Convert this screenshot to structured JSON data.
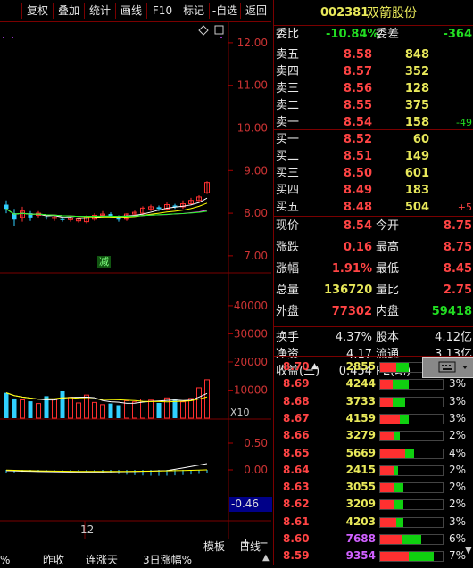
{
  "toolbar": {
    "items": [
      "复权",
      "叠加",
      "统计",
      "画线",
      "F10",
      "标记",
      "-自选",
      "返回"
    ]
  },
  "stock": {
    "code": "002381",
    "name": "双箭股份"
  },
  "order_stats": {
    "wb_label": "委比",
    "wb_value": "-10.84%",
    "wc_label": "委差",
    "wc_value": "-364"
  },
  "asks": [
    {
      "label": "卖五",
      "price": "8.58",
      "vol": "848",
      "chg": ""
    },
    {
      "label": "卖四",
      "price": "8.57",
      "vol": "352",
      "chg": ""
    },
    {
      "label": "卖三",
      "price": "8.56",
      "vol": "128",
      "chg": ""
    },
    {
      "label": "卖二",
      "price": "8.55",
      "vol": "375",
      "chg": ""
    },
    {
      "label": "卖一",
      "price": "8.54",
      "vol": "158",
      "chg": "-49"
    }
  ],
  "bids": [
    {
      "label": "买一",
      "price": "8.52",
      "vol": "60",
      "chg": ""
    },
    {
      "label": "买二",
      "price": "8.51",
      "vol": "149",
      "chg": ""
    },
    {
      "label": "买三",
      "price": "8.50",
      "vol": "601",
      "chg": ""
    },
    {
      "label": "买四",
      "price": "8.49",
      "vol": "183",
      "chg": ""
    },
    {
      "label": "买五",
      "price": "8.48",
      "vol": "504",
      "chg": "+5"
    }
  ],
  "quote": [
    {
      "l1": "现价",
      "v1": "8.54",
      "c1": "red",
      "l2": "今开",
      "v2": "8.75",
      "c2": "red"
    },
    {
      "l1": "涨跌",
      "v1": "0.16",
      "c1": "red",
      "l2": "最高",
      "v2": "8.75",
      "c2": "red"
    },
    {
      "l1": "涨幅",
      "v1": "1.91%",
      "c1": "red",
      "l2": "最低",
      "v2": "8.45",
      "c2": "red"
    },
    {
      "l1": "总量",
      "v1": "136720",
      "c1": "yellow",
      "l2": "量比",
      "v2": "2.75",
      "c2": "red"
    },
    {
      "l1": "外盘",
      "v1": "77302",
      "c1": "red",
      "l2": "内盘",
      "v2": "59418",
      "c2": "green"
    }
  ],
  "fundamentals": [
    {
      "l1": "换手",
      "v1": "4.37%",
      "l2": "股本",
      "v2": "4.12亿"
    },
    {
      "l1": "净资",
      "v1": "4.17",
      "l2": "流通",
      "v2": "3.13亿"
    },
    {
      "l1": "收益(三)",
      "v1": "0.454",
      "l2": "PE(动)",
      "v2": "14.1"
    }
  ],
  "price_levels": [
    {
      "price": "8.70",
      "vol": "2855",
      "pct": "",
      "red": 0.45,
      "green": 0.35,
      "arrow": true,
      "vcolor": "yellow"
    },
    {
      "price": "8.69",
      "vol": "4244",
      "pct": "3%",
      "red": 0.35,
      "green": 0.45,
      "arrow": false,
      "vcolor": "yellow"
    },
    {
      "price": "8.68",
      "vol": "3733",
      "pct": "3%",
      "red": 0.35,
      "green": 0.35,
      "arrow": false,
      "vcolor": "yellow"
    },
    {
      "price": "8.67",
      "vol": "4159",
      "pct": "3%",
      "red": 0.55,
      "green": 0.25,
      "arrow": false,
      "vcolor": "yellow"
    },
    {
      "price": "8.66",
      "vol": "3279",
      "pct": "2%",
      "red": 0.4,
      "green": 0.15,
      "arrow": false,
      "vcolor": "yellow"
    },
    {
      "price": "8.65",
      "vol": "5669",
      "pct": "4%",
      "red": 0.7,
      "green": 0.25,
      "arrow": false,
      "vcolor": "yellow"
    },
    {
      "price": "8.64",
      "vol": "2415",
      "pct": "2%",
      "red": 0.4,
      "green": 0.1,
      "arrow": false,
      "vcolor": "yellow"
    },
    {
      "price": "8.63",
      "vol": "3055",
      "pct": "2%",
      "red": 0.4,
      "green": 0.25,
      "arrow": false,
      "vcolor": "yellow"
    },
    {
      "price": "8.62",
      "vol": "3209",
      "pct": "2%",
      "red": 0.4,
      "green": 0.25,
      "arrow": false,
      "vcolor": "yellow"
    },
    {
      "price": "8.61",
      "vol": "4203",
      "pct": "3%",
      "red": 0.45,
      "green": 0.2,
      "arrow": false,
      "vcolor": "yellow"
    },
    {
      "price": "8.60",
      "vol": "7688",
      "pct": "6%",
      "red": 0.6,
      "green": 0.55,
      "arrow": false,
      "vcolor": "purple"
    },
    {
      "price": "8.59",
      "vol": "9354",
      "pct": "7%",
      "red": 0.8,
      "green": 0.7,
      "arrow": false,
      "vcolor": "purple"
    }
  ],
  "chart": {
    "price_ticks": [
      "12.00",
      "11.00",
      "10.00",
      "9.00",
      "8.00",
      "7.00"
    ],
    "volume_ticks": [
      "40000",
      "30000",
      "20000",
      "10000"
    ],
    "volume_unit": "X10",
    "macd_ticks": [
      "0.50",
      "0.00"
    ],
    "macd_value": "-0.46",
    "date_label": "12",
    "marker_label": "减",
    "price_range": [
      6.6,
      12.5
    ],
    "volume_range": [
      0,
      46000
    ],
    "macd_range": [
      -0.95,
      0.95
    ],
    "candles": [
      {
        "o": 8.2,
        "c": 8.1,
        "h": 8.3,
        "l": 8.0
      },
      {
        "o": 8.0,
        "c": 7.85,
        "h": 8.1,
        "l": 7.7
      },
      {
        "o": 7.9,
        "c": 8.05,
        "h": 8.15,
        "l": 7.8
      },
      {
        "o": 8.0,
        "c": 7.9,
        "h": 8.05,
        "l": 7.82
      },
      {
        "o": 7.95,
        "c": 8.0,
        "h": 8.05,
        "l": 7.9
      },
      {
        "o": 7.9,
        "c": 7.88,
        "h": 7.95,
        "l": 7.85
      },
      {
        "o": 7.88,
        "c": 7.9,
        "h": 7.95,
        "l": 7.82
      },
      {
        "o": 7.86,
        "c": 7.85,
        "h": 7.92,
        "l": 7.8
      },
      {
        "o": 7.85,
        "c": 7.88,
        "h": 7.92,
        "l": 7.8
      },
      {
        "o": 7.82,
        "c": 7.86,
        "h": 7.9,
        "l": 7.78
      },
      {
        "o": 7.8,
        "c": 7.92,
        "h": 7.95,
        "l": 7.76
      },
      {
        "o": 7.86,
        "c": 7.95,
        "h": 8.0,
        "l": 7.82
      },
      {
        "o": 7.95,
        "c": 7.98,
        "h": 8.05,
        "l": 7.9
      },
      {
        "o": 7.98,
        "c": 7.92,
        "h": 8.02,
        "l": 7.88
      },
      {
        "o": 7.92,
        "c": 7.85,
        "h": 7.95,
        "l": 7.8
      },
      {
        "o": 7.86,
        "c": 7.98,
        "h": 8.0,
        "l": 7.82
      },
      {
        "o": 7.98,
        "c": 8.02,
        "h": 8.06,
        "l": 7.94
      },
      {
        "o": 8.0,
        "c": 8.12,
        "h": 8.16,
        "l": 7.96
      },
      {
        "o": 8.1,
        "c": 8.15,
        "h": 8.2,
        "l": 8.05
      },
      {
        "o": 8.14,
        "c": 8.1,
        "h": 8.18,
        "l": 8.05
      },
      {
        "o": 8.1,
        "c": 8.2,
        "h": 8.25,
        "l": 8.06
      },
      {
        "o": 8.18,
        "c": 8.15,
        "h": 8.22,
        "l": 8.1
      },
      {
        "o": 8.15,
        "c": 8.22,
        "h": 8.3,
        "l": 8.1
      },
      {
        "o": 8.22,
        "c": 8.3,
        "h": 8.36,
        "l": 8.18
      },
      {
        "o": 8.3,
        "c": 8.38,
        "h": 8.42,
        "l": 8.26
      },
      {
        "o": 8.48,
        "c": 8.72,
        "h": 8.75,
        "l": 8.45
      }
    ],
    "volumes": [
      9000,
      7000,
      6500,
      6000,
      5200,
      7800,
      6800,
      9600,
      7400,
      5400,
      8200,
      5600,
      4800,
      5200,
      4600,
      6200,
      5800,
      6800,
      6400,
      5400,
      7200,
      6600,
      5800,
      7000,
      10800,
      13672
    ]
  }
}
